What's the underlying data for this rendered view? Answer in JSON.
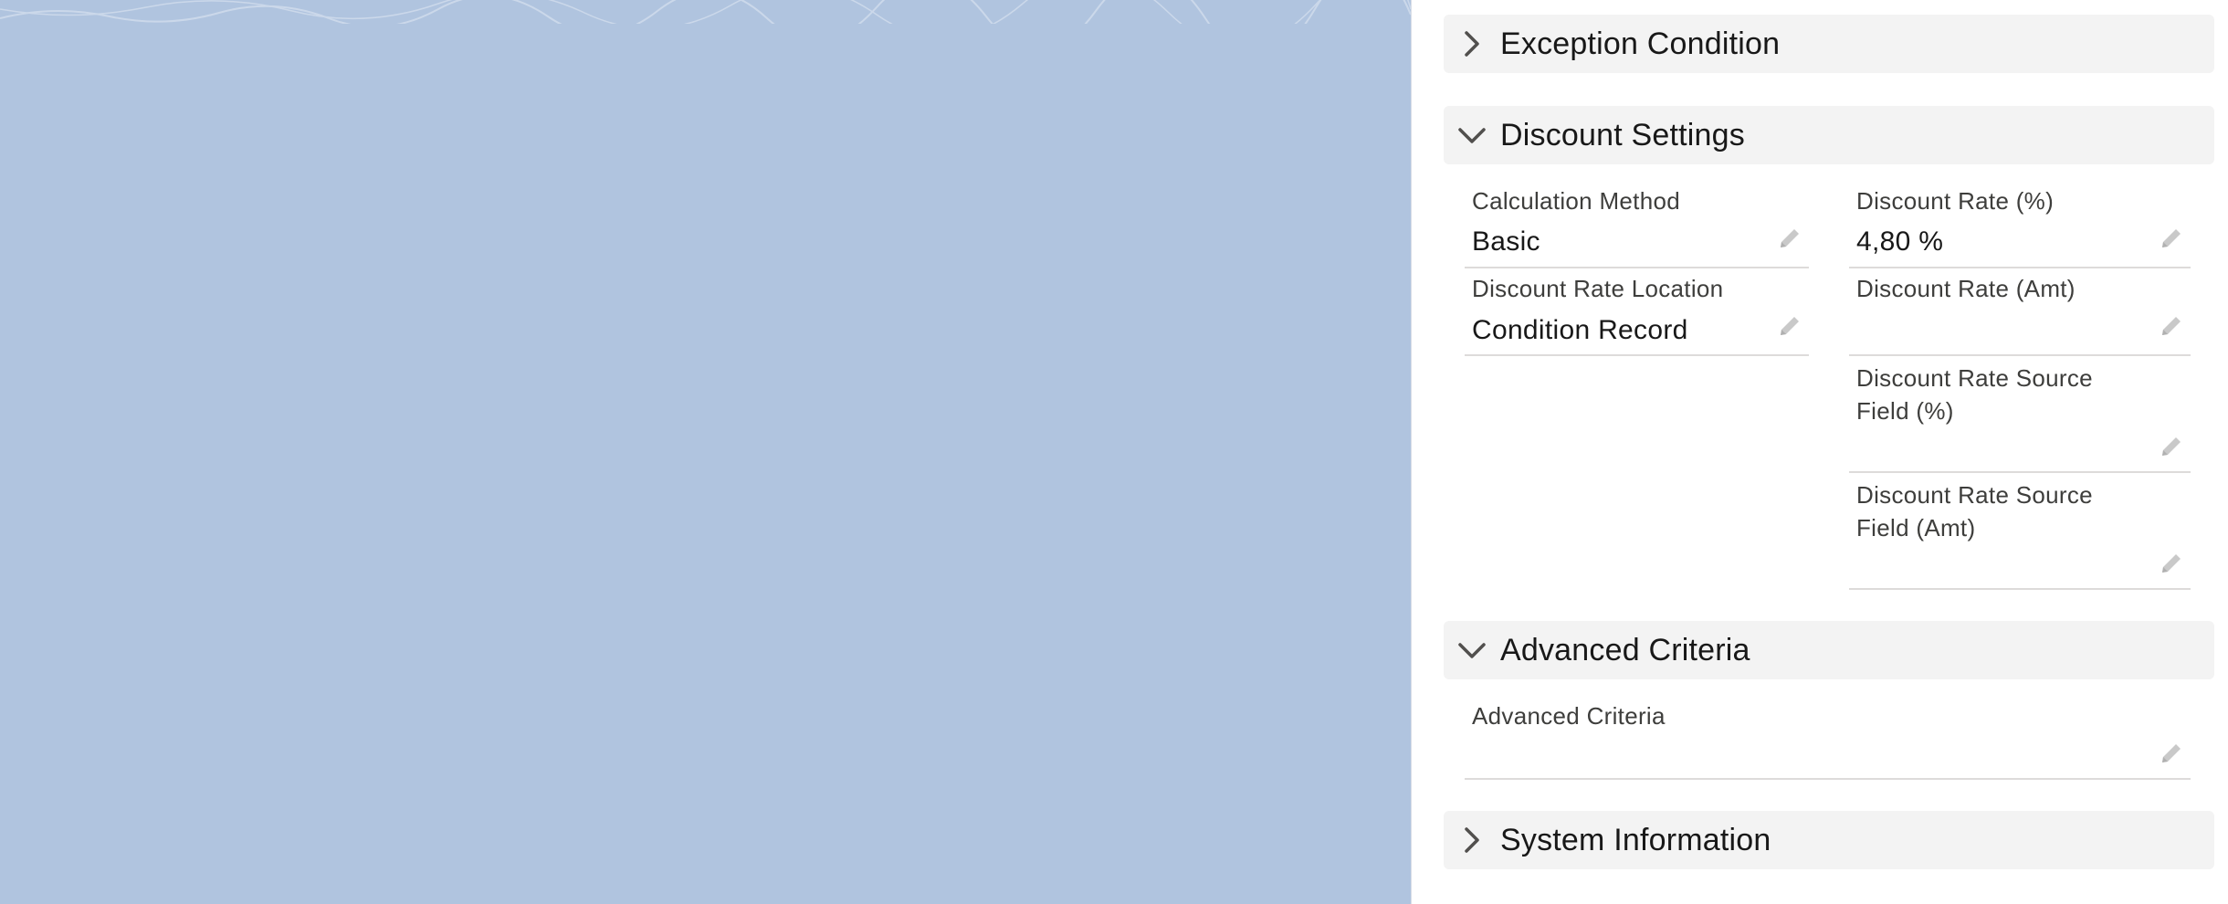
{
  "sections": {
    "exception_condition": {
      "title": "Exception Condition",
      "expanded": false
    },
    "discount_settings": {
      "title": "Discount Settings",
      "expanded": true,
      "fields": {
        "calculation_method": {
          "label": "Calculation Method",
          "value": "Basic"
        },
        "discount_rate_location": {
          "label": "Discount Rate Location",
          "value": "Condition Record"
        },
        "discount_rate_pct": {
          "label": "Discount Rate (%)",
          "value": "4,80 %"
        },
        "discount_rate_amt": {
          "label": "Discount Rate (Amt)",
          "value": ""
        },
        "discount_rate_source_pct": {
          "label": "Discount Rate Source Field (%)",
          "value": ""
        },
        "discount_rate_source_amt": {
          "label": "Discount Rate Source Field (Amt)",
          "value": ""
        }
      }
    },
    "advanced_criteria": {
      "title": "Advanced Criteria",
      "expanded": true,
      "fields": {
        "advanced_criteria": {
          "label": "Advanced Criteria",
          "value": ""
        }
      }
    },
    "system_information": {
      "title": "System Information",
      "expanded": false
    }
  },
  "icons": {
    "collapsed": "chevron-right-icon",
    "expanded": "chevron-down-icon",
    "edit": "pencil-icon"
  },
  "colors": {
    "background": "#b0c4df",
    "panel": "#ffffff",
    "section_header": "#f3f3f3",
    "icon_gray": "#c9c9c9"
  }
}
